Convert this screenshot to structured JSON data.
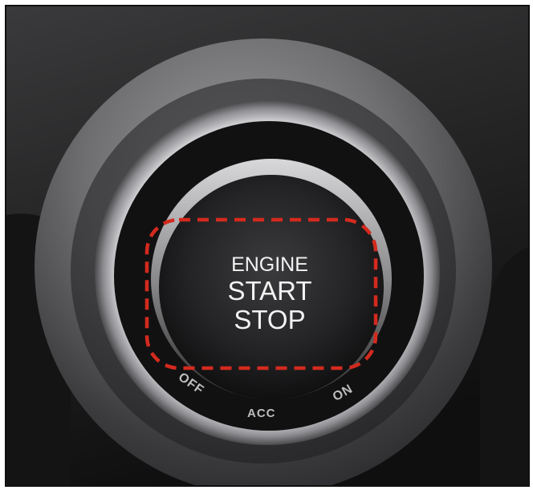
{
  "button": {
    "line1": "ENGINE",
    "line2": "START",
    "line3": "STOP"
  },
  "positions": {
    "off": "OFF",
    "acc": "ACC",
    "on": "ON"
  },
  "colors": {
    "highlight": "#d42a1e",
    "button_text": "#f2f2f2",
    "position_text": "#bdbdbd"
  }
}
